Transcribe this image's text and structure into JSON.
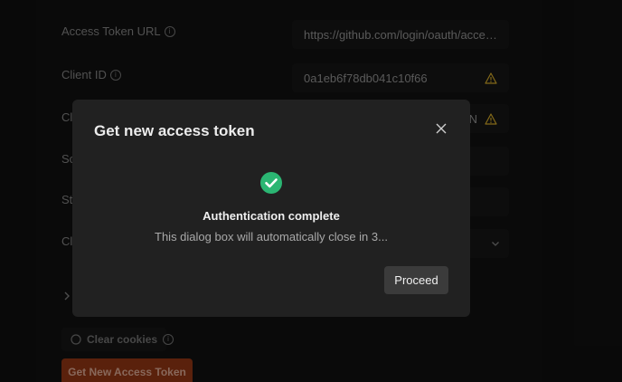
{
  "form": {
    "access_token_url_label": "Access Token URL",
    "access_token_url_value": "https://github.com/login/oauth/access_token",
    "client_id_label": "Client ID",
    "client_id_value": "0a1eb6f78db041c10f66",
    "client_secret_label_partial": "Cl",
    "client_secret_value_partial": "N",
    "scope_label_partial": "Sc",
    "state_label_partial": "St",
    "client_auth_label_partial": "Cl",
    "clear_cookies_label": "Clear cookies",
    "get_new_token_label": "Get New Access Token"
  },
  "dialog": {
    "title": "Get new access token",
    "status_title": "Authentication complete",
    "status_message": "This dialog box will automatically close in 3...",
    "proceed_label": "Proceed"
  },
  "icons": {
    "info": "info-icon",
    "warning": "warning-icon",
    "close": "close-icon",
    "success": "check-circle-icon",
    "chevron": "chevron-down-icon",
    "cookie": "cookie-icon"
  },
  "colors": {
    "success": "#2bb673",
    "warning": "#c9a227",
    "primary_button": "#8a3413"
  }
}
